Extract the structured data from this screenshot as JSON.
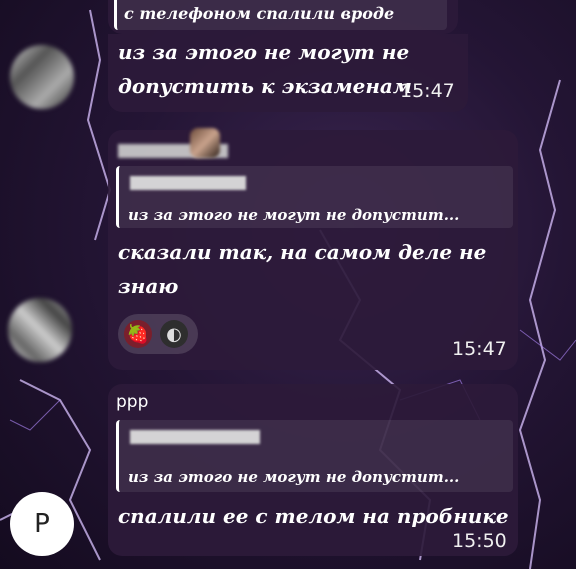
{
  "messages": [
    {
      "text_lines": [
        "с телефоном спалили вроде"
      ]
    },
    {
      "text_lines": [
        "из за этого не могут не",
        "допустить к экзаменам"
      ],
      "time": "15:47"
    },
    {
      "quote_text": "из за этого не могут не допустит...",
      "text_lines": [
        "сказали так, на самом деле не",
        "знаю"
      ],
      "reactions": [
        {
          "icon": "strawberry-icon",
          "glyph": "🍓"
        },
        {
          "icon": "sticker-icon",
          "glyph": "◐"
        }
      ],
      "time": "15:47"
    },
    {
      "sender": "ррр",
      "quote_text": "из за этого не могут не допустит...",
      "text_lines": [
        "спалили ее с телом на пробнике"
      ],
      "time": "15:50",
      "avatar_letter": "Р"
    }
  ]
}
